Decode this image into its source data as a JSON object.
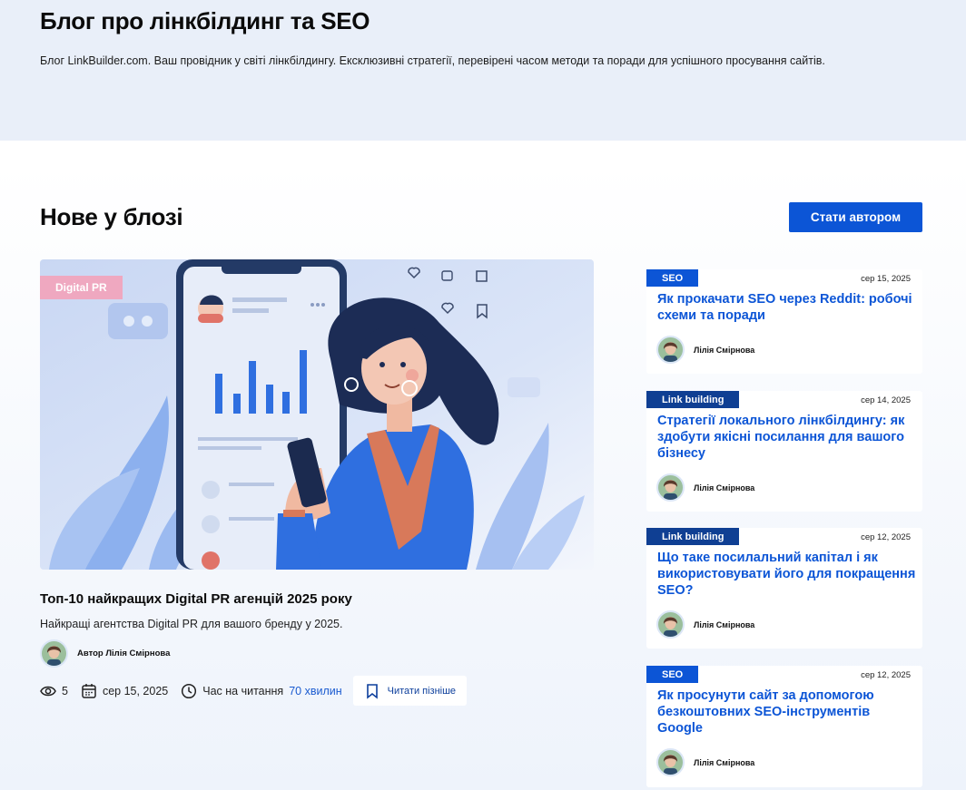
{
  "hero": {
    "title": "Блог про лінкбілдинг та SEO",
    "subtitle": "Блог LinkBuilder.com. Ваш провідник у світі лінкбілдингу. Ексклюзивні стратегії, перевірені часом методи та поради для успішного просування сайтів."
  },
  "section": {
    "title": "Нове у блозі",
    "author_button": "Стати автором"
  },
  "featured": {
    "category": "Digital PR",
    "title": "Топ-10 найкращих Digital PR агенцій 2025 року",
    "description": "Найкращі агентства Digital PR для вашого бренду у 2025.",
    "author_label": "Автор Лілія Смірнова",
    "views": "5",
    "date": "сер 15, 2025",
    "read_time_label": "Час на читання",
    "read_time_value": "70 хвилин",
    "read_later": "Читати пізніше"
  },
  "cards": [
    {
      "tag": "SEO",
      "date": "сер 15, 2025",
      "title": "Як прокачати SEO через Reddit: робочі схеми та поради",
      "author": "Лілія Смірнова"
    },
    {
      "tag": "Link building",
      "date": "сер 14, 2025",
      "title": "Стратегії локального лінкбілдингу: як здобути якісні посилання для вашого бізнесу",
      "author": "Лілія Смірнова"
    },
    {
      "tag": "Link building",
      "date": "сер 12, 2025",
      "title": "Що таке посилальний капітал і як використовувати його для покращення SEO?",
      "author": "Лілія Смірнова"
    },
    {
      "tag": "SEO",
      "date": "сер 12, 2025",
      "title": "Як просунути сайт за допомогою безкоштовних SEO-інструментів Google",
      "author": "Лілія Смірнова"
    }
  ],
  "colors": {
    "primary": "#0c55d6",
    "tag_dark": "#0f3f93",
    "pink_tag": "#efa8c0",
    "hero_bg": "#e9eff9"
  }
}
